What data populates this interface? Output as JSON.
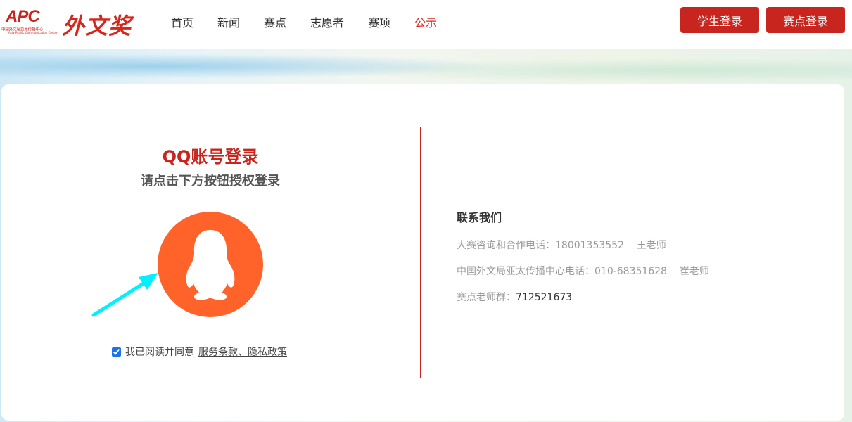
{
  "header": {
    "logo_apc": "APC",
    "logo_sub_cn": "中国外文局亚太传播中心",
    "logo_sub_en": "Asia-Pacific Communication Center",
    "brand": "外文奖",
    "nav": [
      {
        "label": "首页",
        "active": false
      },
      {
        "label": "新闻",
        "active": false
      },
      {
        "label": "赛点",
        "active": false
      },
      {
        "label": "志愿者",
        "active": false
      },
      {
        "label": "赛项",
        "active": false
      },
      {
        "label": "公示",
        "active": true
      }
    ],
    "student_login": "学生登录",
    "venue_login": "赛点登录"
  },
  "login": {
    "title": "QQ账号登录",
    "subtitle": "请点击下方按钮授权登录",
    "agree_text": "我已阅读并同意",
    "agree_link": "服务条款、隐私政策",
    "agree_checked": true
  },
  "contact": {
    "title": "联系我们",
    "lines": [
      {
        "label": "大赛咨询和合作电话：",
        "value": "18001353552",
        "person": "王老师"
      },
      {
        "label": "中国外文局亚太传播中心电话：",
        "value": "010-68351628",
        "person": "崔老师"
      }
    ],
    "group_label": "赛点老师群：",
    "group_value": "712521673"
  },
  "colors": {
    "brand_red": "#c8251e",
    "qq_orange": "#ff6329",
    "arrow_cyan": "#00f0ff"
  }
}
